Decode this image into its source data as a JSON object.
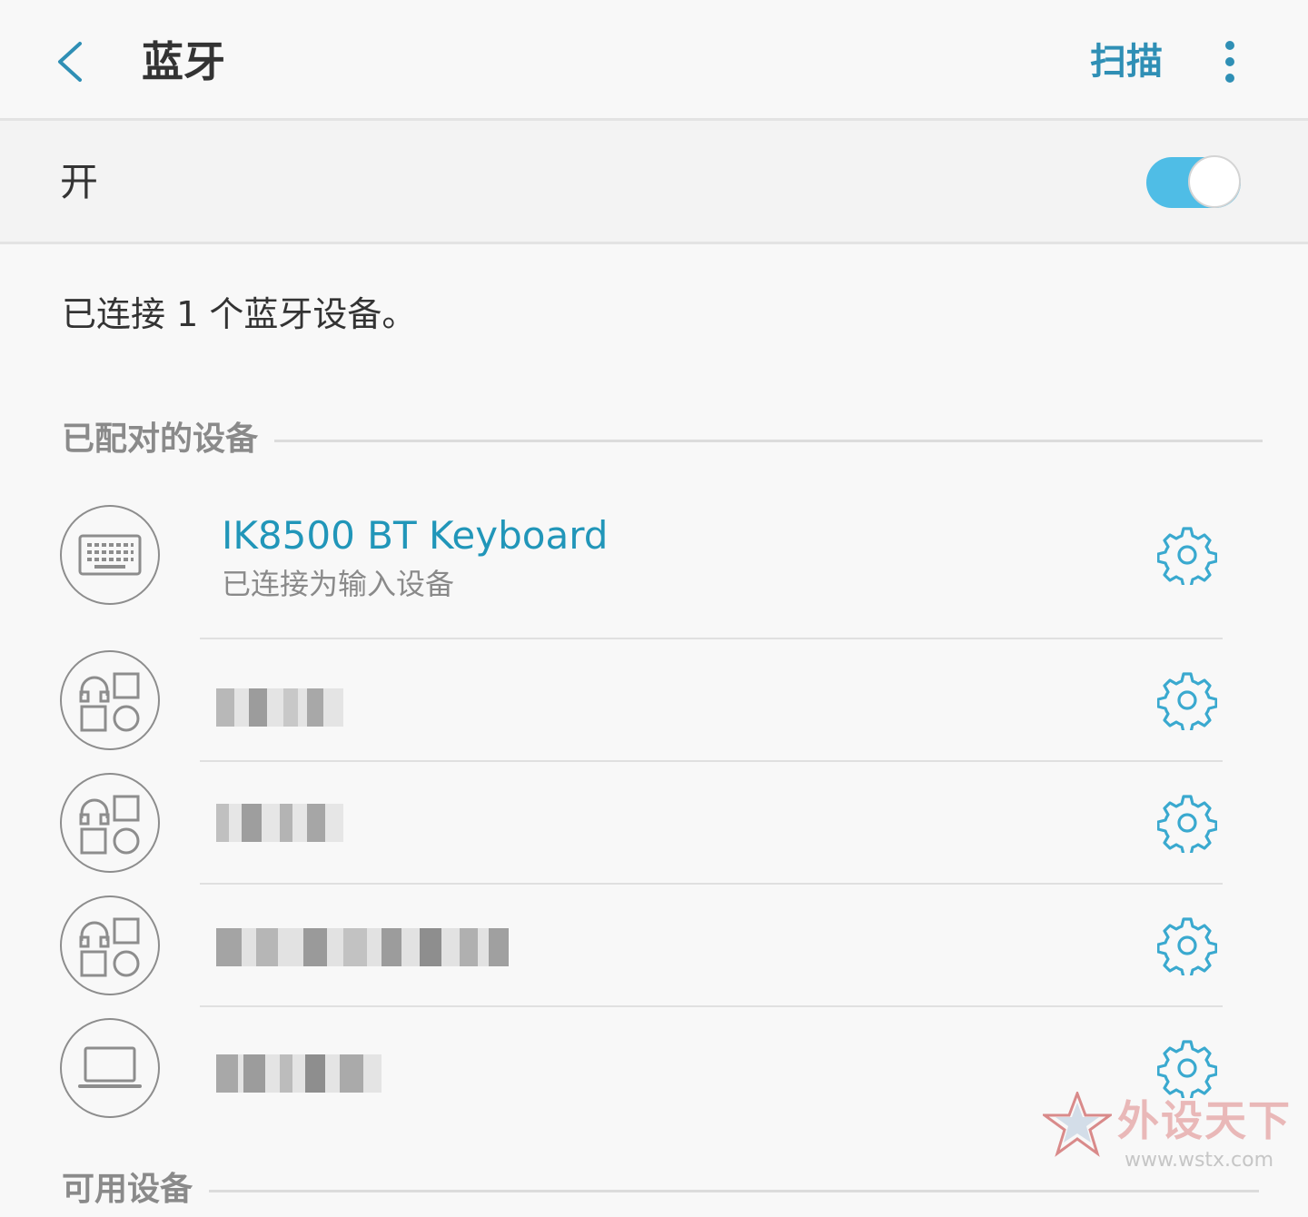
{
  "header": {
    "title": "蓝牙",
    "scan_label": "扫描",
    "back_icon": "chevron-left-icon",
    "more_icon": "more-vertical-icon",
    "accent_color": "#2f8fb5"
  },
  "toggle": {
    "label": "开",
    "state": "on",
    "color": "#4fbde6"
  },
  "status": {
    "text": "已连接 1 个蓝牙设备。"
  },
  "paired_section": {
    "label": "已配对的设备",
    "devices": [
      {
        "name": "IK8500 BT Keyboard",
        "sub": "已连接为输入设备",
        "icon": "keyboard-icon",
        "connected": true
      },
      {
        "icon": "headset-grid-icon",
        "connected": false
      },
      {
        "icon": "headset-grid-icon",
        "connected": false
      },
      {
        "icon": "headset-grid-icon",
        "connected": false
      },
      {
        "icon": "laptop-icon",
        "connected": false
      }
    ]
  },
  "available_section": {
    "label": "可用设备"
  },
  "watermark": {
    "brand": "外设天下",
    "url": "www.wstx.com"
  }
}
